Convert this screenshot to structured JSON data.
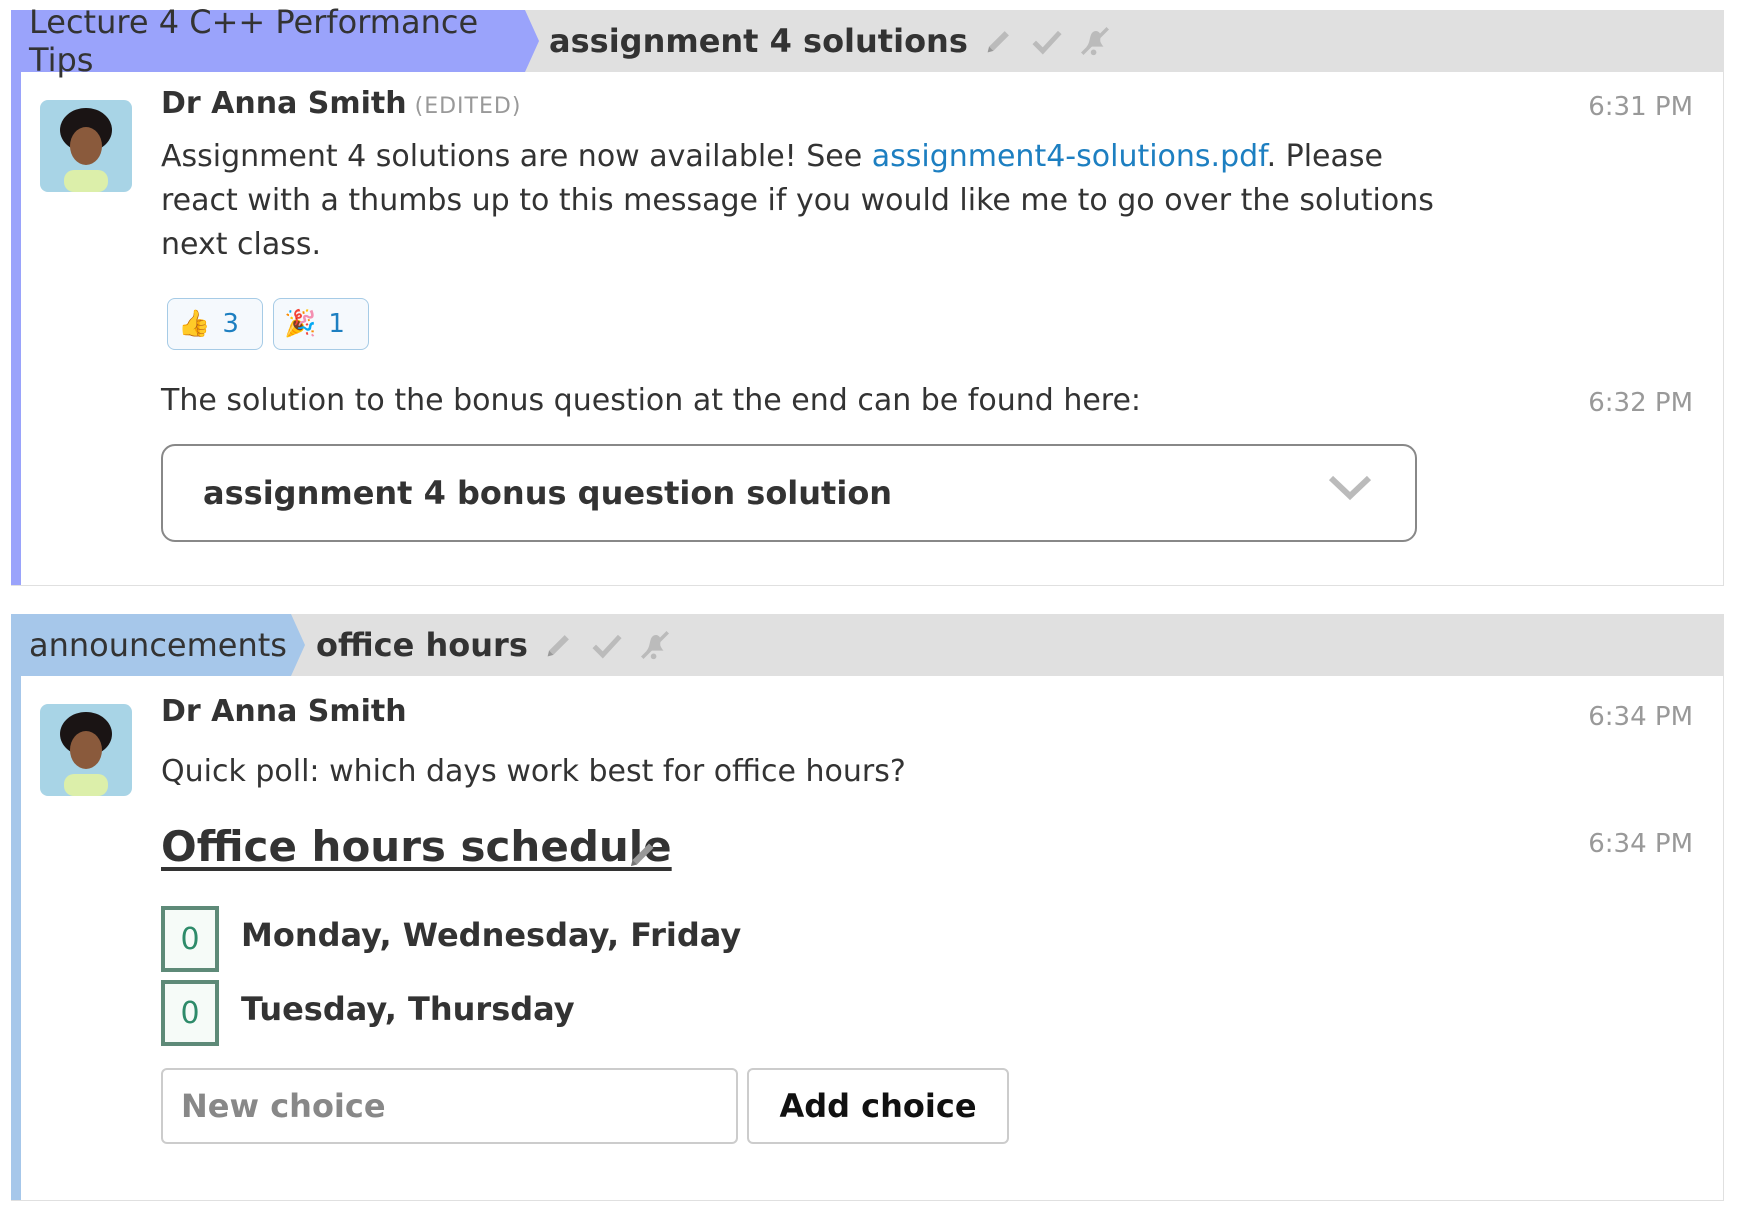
{
  "groups": [
    {
      "stream": "Lecture 4 C++ Performance Tips",
      "stream_color": "#9aa3fb",
      "topic": "assignment 4 solutions",
      "messages": [
        {
          "sender": "Dr Anna Smith",
          "edited": "(EDITED)",
          "time": "6:31 PM",
          "text_before_link": "Assignment 4 solutions are now available! See ",
          "link_text": "assignment4-solutions.pdf",
          "text_after_link": ". Please react with a thumbs up to this message if you would like me to go over the solutions next class.",
          "reactions": [
            {
              "emoji": "👍",
              "count": "3"
            },
            {
              "emoji": "🎉",
              "count": "1"
            }
          ]
        },
        {
          "time": "6:32 PM",
          "text": "The solution to the bonus question at the end can be found here:",
          "spoiler_header": "assignment 4 bonus question solution"
        }
      ]
    },
    {
      "stream": "announcements",
      "stream_color": "#a6c7ea",
      "topic": "office hours",
      "messages": [
        {
          "sender": "Dr Anna Smith",
          "time": "6:34 PM",
          "text": "Quick poll: which days work best for office hours?"
        },
        {
          "time": "6:34 PM",
          "poll": {
            "title": "Office hours schedule",
            "options": [
              {
                "votes": "0",
                "label": "Monday, Wednesday, Friday"
              },
              {
                "votes": "0",
                "label": "Tuesday, Thursday"
              }
            ],
            "new_choice_placeholder": "New choice",
            "add_choice_label": "Add choice"
          }
        }
      ]
    }
  ]
}
